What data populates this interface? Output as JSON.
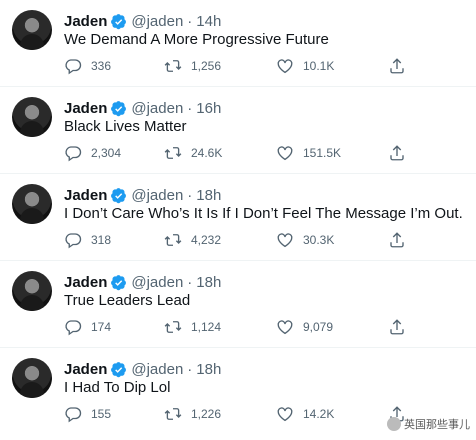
{
  "tweets": [
    {
      "name": "Jaden",
      "handle": "@jaden",
      "time": "14h",
      "text": "We Demand A More Progressive Future",
      "replies": "336",
      "retweets": "1,256",
      "likes": "10.1K"
    },
    {
      "name": "Jaden",
      "handle": "@jaden",
      "time": "16h",
      "text": "Black Lives Matter",
      "replies": "2,304",
      "retweets": "24.6K",
      "likes": "151.5K"
    },
    {
      "name": "Jaden",
      "handle": "@jaden",
      "time": "18h",
      "text": "I Don’t Care Who’s It Is If I Don’t Feel The Message I’m Out.",
      "replies": "318",
      "retweets": "4,232",
      "likes": "30.3K"
    },
    {
      "name": "Jaden",
      "handle": "@jaden",
      "time": "18h",
      "text": "True Leaders Lead",
      "replies": "174",
      "retweets": "1,124",
      "likes": "9,079"
    },
    {
      "name": "Jaden",
      "handle": "@jaden",
      "time": "18h",
      "text": "I Had To Dip Lol",
      "replies": "155",
      "retweets": "1,226",
      "likes": "14.2K"
    }
  ],
  "separator": "·",
  "watermark": "英国那些事儿",
  "icons": {
    "verified": "verified-badge-icon",
    "reply": "reply-icon",
    "retweet": "retweet-icon",
    "like": "heart-icon",
    "share": "share-icon"
  },
  "colors": {
    "verified": "#1d9bf0",
    "muted": "#536471",
    "text": "#0f1419"
  }
}
